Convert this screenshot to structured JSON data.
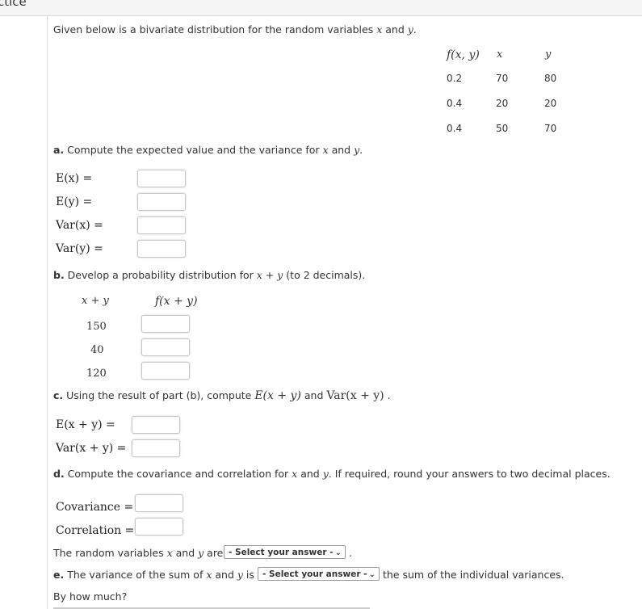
{
  "header": {
    "title": "ctice"
  },
  "intro": {
    "text_before": "Given below is a bivariate distribution for the random variables ",
    "x": "x",
    "and": " and ",
    "y": "y",
    "end": "."
  },
  "distribution_table": {
    "headers": [
      "f(x, y)",
      "x",
      "y"
    ],
    "rows": [
      [
        "0.2",
        "70",
        "80"
      ],
      [
        "0.4",
        "20",
        "20"
      ],
      [
        "0.4",
        "50",
        "70"
      ]
    ]
  },
  "part_a": {
    "letter": "a.",
    "text": " Compute the expected value and the variance for ",
    "x": "x",
    "and": " and ",
    "y": "y",
    "end": ".",
    "fields": [
      {
        "label": "E(x) =",
        "value": ""
      },
      {
        "label": "E(y) =",
        "value": ""
      },
      {
        "label": "Var(x) =",
        "value": ""
      },
      {
        "label": "Var(y) =",
        "value": ""
      }
    ]
  },
  "part_b": {
    "letter": "b.",
    "text": " Develop a probability distribution for ",
    "expr": "x + y",
    "end": " (to 2 decimals).",
    "col_headers": [
      "x + y",
      "f(x + y)"
    ],
    "rows": [
      {
        "sum": "150",
        "value": ""
      },
      {
        "sum": "40",
        "value": ""
      },
      {
        "sum": "120",
        "value": ""
      }
    ]
  },
  "part_c": {
    "letter": "c.",
    "text": " Using the result of part (b), compute ",
    "e_expr": "E(x + y)",
    "and": " and ",
    "var_expr": "Var(x + y)",
    "end": " .",
    "fields": [
      {
        "label": "E(x + y) =",
        "value": ""
      },
      {
        "label": "Var(x + y) =",
        "value": ""
      }
    ]
  },
  "part_d": {
    "letter": "d.",
    "text": " Compute the covariance and correlation for ",
    "x": "x",
    "and": " and ",
    "y": "y",
    "end": ". If required, round your answers to two decimal places.",
    "fields": [
      {
        "label": "Covariance =",
        "value": ""
      },
      {
        "label": "Correlation =",
        "value": ""
      }
    ],
    "relation": {
      "before": "The random variables ",
      "x": "x",
      "and": " and ",
      "y": "y",
      "are": " are",
      "select": "- Select your answer -",
      "end": "."
    }
  },
  "part_e": {
    "letter": "e.",
    "text": " The variance of the sum of ",
    "x": "x",
    "and": " and ",
    "y": "y",
    "is": " is",
    "select": "- Select your answer -",
    "end": "the sum of the individual variances.",
    "followup": "By how much?"
  }
}
